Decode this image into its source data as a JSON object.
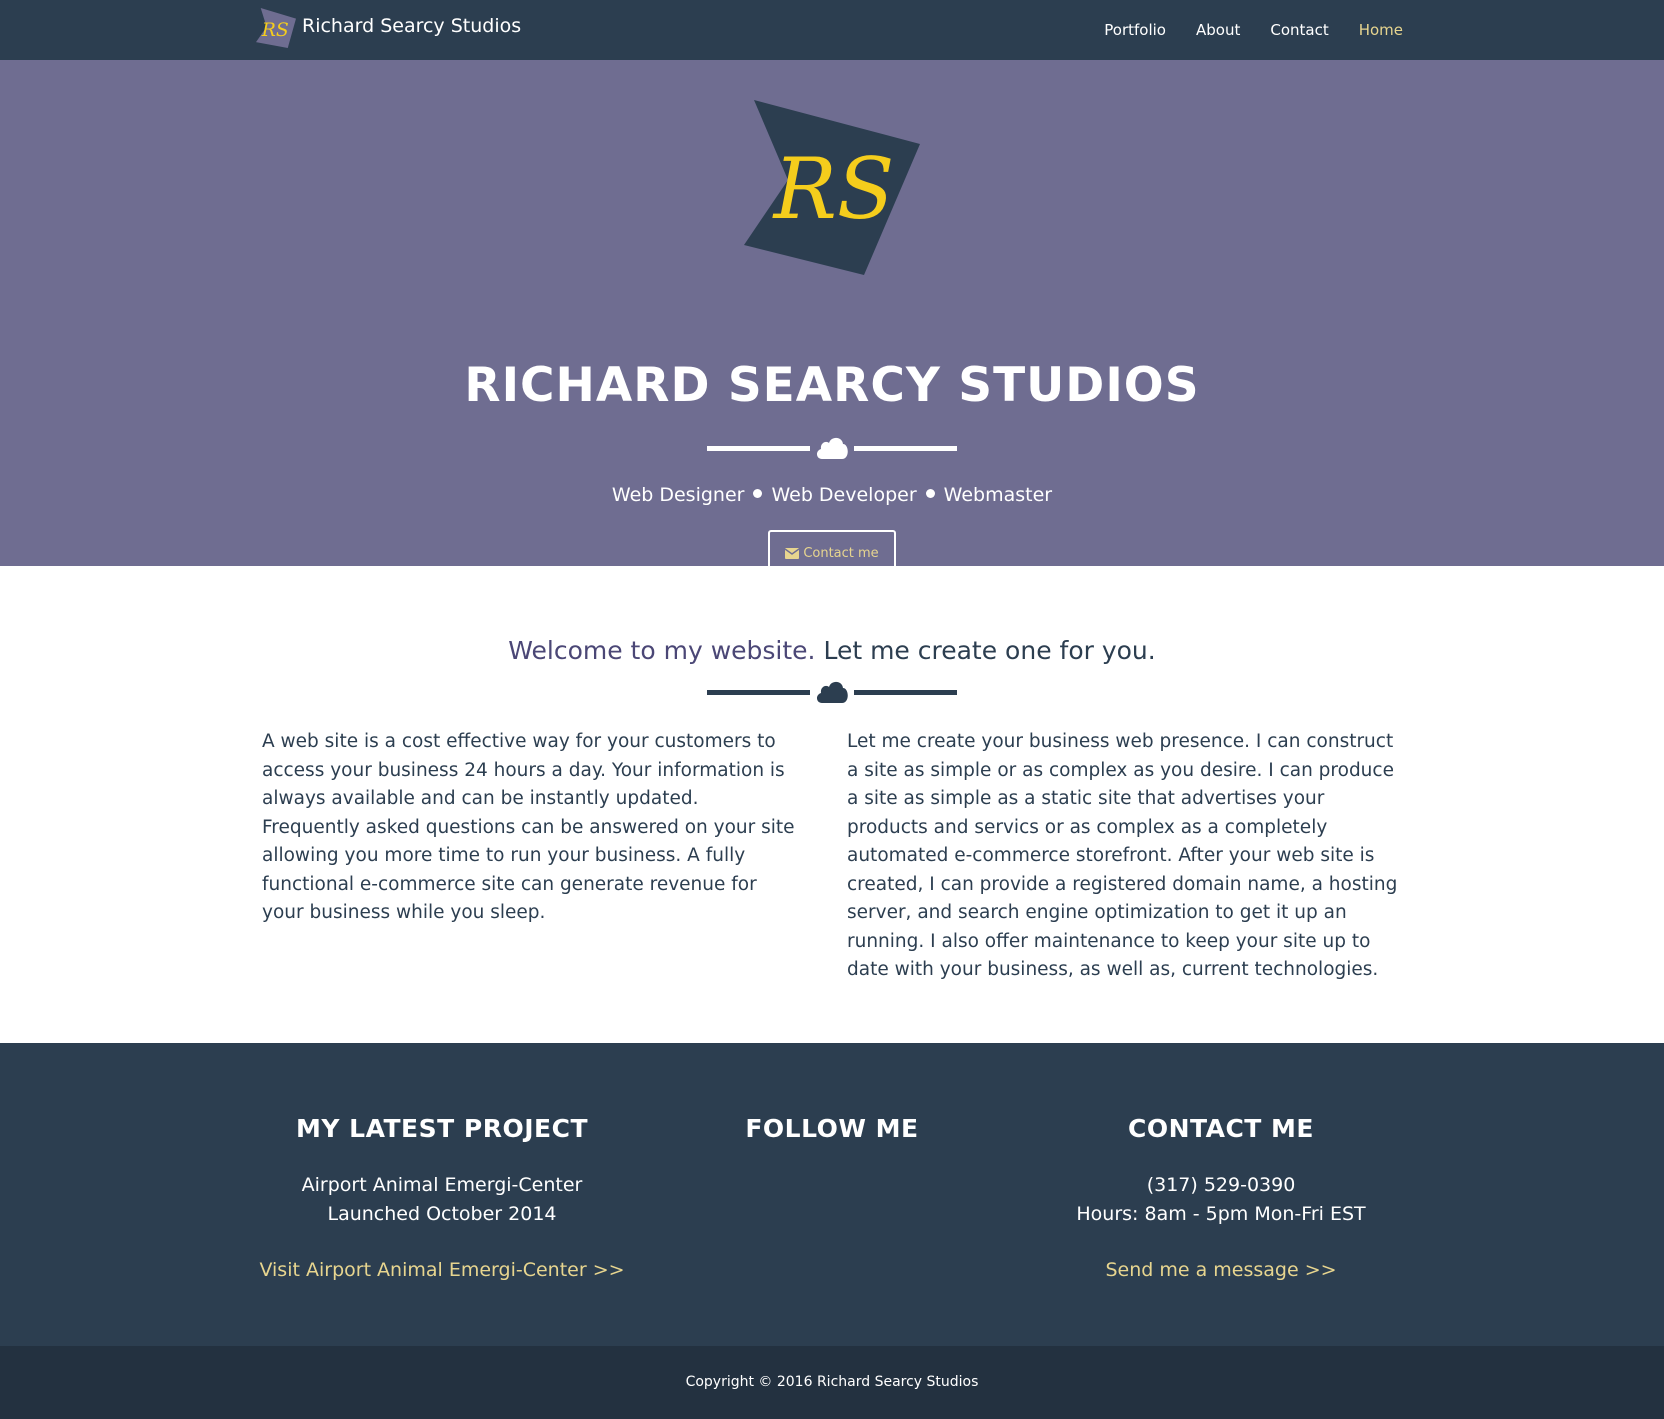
{
  "nav": {
    "brand": "Richard Searcy Studios",
    "links": [
      "Portfolio",
      "About",
      "Contact",
      "Home"
    ],
    "active": "Home"
  },
  "hero": {
    "logo_icon": "rs-flag-logo",
    "title": "RICHARD SEARCY STUDIOS",
    "divider_icon": "cloud-icon",
    "skills": [
      "Web Designer",
      "Web Developer",
      "Webmaster"
    ],
    "button_label": "Contact me",
    "button_icon": "envelope-icon"
  },
  "welcome": {
    "title_part1": "Welcome to my website.",
    "title_part2": "Let me create one for you.",
    "left_text": "A web site is a cost effective way for your customers to access your business 24 hours a day. Your information is always available and can be instantly updated. Frequently asked questions can be answered on your site allowing you more time to run your business. A fully functional e-commerce site can generate revenue for your business while you sleep.",
    "right_text": "Let me create your business web presence. I can construct a site as simple or as complex as you desire. I can produce a site as simple as a static site that advertises your products and servics or as complex as a completely automated e-commerce storefront. After your web site is created, I can provide a registered domain name, a hosting server, and search engine optimization to get it up an running. I also offer maintenance to keep your site up to date with your business, as well as, current technologies."
  },
  "footer": {
    "project": {
      "heading": "MY LATEST PROJECT",
      "line1": "Airport Animal Emergi-Center",
      "line2": "Launched October 2014",
      "link": "Visit Airport Animal Emergi-Center >>"
    },
    "follow": {
      "heading": "FOLLOW ME"
    },
    "contact": {
      "heading": "CONTACT ME",
      "phone": "(317) 529-0390",
      "hours": "Hours: 8am - 5pm Mon-Fri EST",
      "link": "Send me a message >>"
    }
  },
  "copyright": "Copyright © 2016 Richard Searcy Studios",
  "colors": {
    "navy": "#2c3e50",
    "purple": "#6f6d91",
    "gold": "#e7d58f",
    "logo_yellow": "#f5cd1c",
    "dark_footer": "#233140"
  }
}
